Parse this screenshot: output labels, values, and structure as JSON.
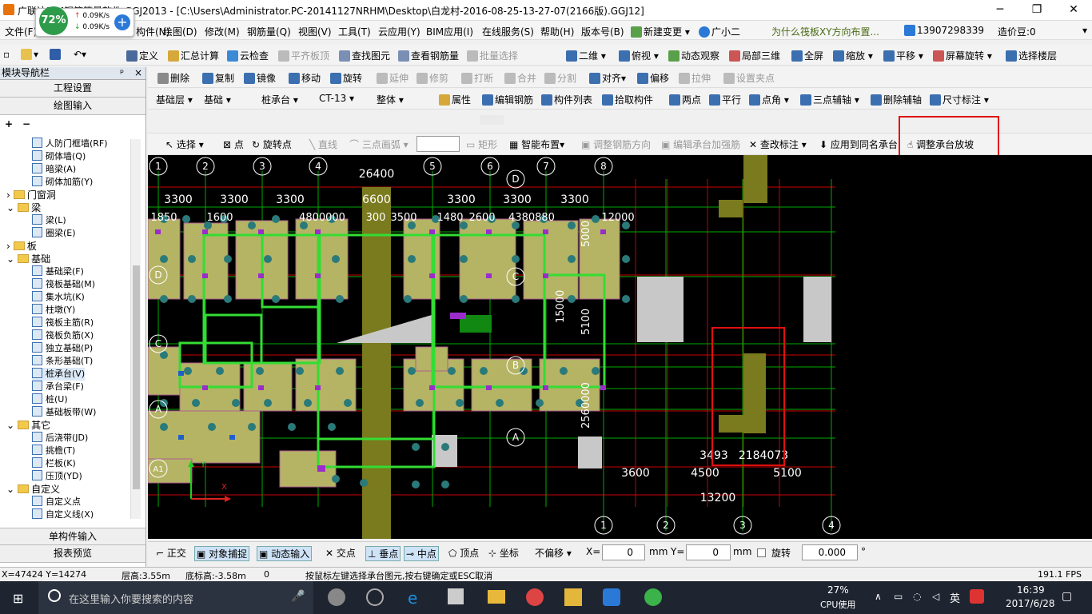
{
  "window": {
    "title": "广联达BIM钢筋算量软件 GGJ2013 - [C:\\Users\\Administrator.PC-20141127NRHM\\Desktop\\白龙村-2016-08-25-13-27-07(2166版).GGJ12]",
    "minimize": "─",
    "maximize": "❐",
    "close": "✕"
  },
  "speed": {
    "percent": "72%",
    "up": "0.09K/s",
    "down": "0.09K/s"
  },
  "menu": [
    "文件(F)",
    "编辑(E)",
    "楼层(L)",
    "构件(N)",
    "绘图(D)",
    "修改(M)",
    "钢筋量(Q)",
    "视图(V)",
    "工具(T)",
    "云应用(Y)",
    "BIM应用(I)",
    "在线服务(S)",
    "帮助(H)",
    "版本号(B)",
    "新建变更 ▾",
    "广小二"
  ],
  "help_question": "为什么筏板XY方向布置...",
  "phone": "13907298339",
  "price": "造价豆:0",
  "toolbar1": [
    "定义",
    "汇总计算",
    "云检查",
    "平齐板顶",
    "查找图元",
    "查看钢筋量",
    "批量选择",
    "二维",
    "俯视",
    "动态观察",
    "局部三维",
    "全屏",
    "缩放",
    "平移",
    "屏幕旋转",
    "选择楼层"
  ],
  "toolbar2": [
    "删除",
    "复制",
    "镜像",
    "移动",
    "旋转",
    "延伸",
    "修剪",
    "打断",
    "合并",
    "分割",
    "对齐",
    "偏移",
    "拉伸",
    "设置夹点"
  ],
  "toolbar3": {
    "floor_type": "基础层",
    "floor": "基础",
    "component_type": "桩承台",
    "component": "CT-13",
    "mode": "整体",
    "items": [
      "属性",
      "编辑钢筋",
      "构件列表",
      "拾取构件",
      "两点",
      "平行",
      "点角",
      "三点辅轴",
      "删除辅轴",
      "尺寸标注"
    ]
  },
  "toolbar4": {
    "items": [
      "选择",
      "点",
      "旋转点",
      "直线",
      "三点画弧",
      "矩形",
      "智能布置",
      "调整钢筋方向",
      "编辑承台加强筋",
      "查改标注",
      "应用到同名承台",
      "调整承台放坡"
    ]
  },
  "panel": {
    "title": "模块导航栏",
    "pin": "ᵖ",
    "close": "×",
    "btn_project": "工程设置",
    "btn_draw": "绘图输入",
    "btn_single": "单构件输入",
    "btn_report": "报表预览"
  },
  "tree": [
    {
      "t": "人防门框墙(RF)",
      "lvl": 2
    },
    {
      "t": "砌体墙(Q)",
      "lvl": 2
    },
    {
      "t": "暗梁(A)",
      "lvl": 2
    },
    {
      "t": "砌体加筋(Y)",
      "lvl": 2
    },
    {
      "t": "门窗洞",
      "lvl": 1,
      "g": true,
      "s": "›"
    },
    {
      "t": "梁",
      "lvl": 1,
      "g": true,
      "s": "⌄"
    },
    {
      "t": "梁(L)",
      "lvl": 2
    },
    {
      "t": "圈梁(E)",
      "lvl": 2
    },
    {
      "t": "板",
      "lvl": 1,
      "g": true,
      "s": "›"
    },
    {
      "t": "基础",
      "lvl": 1,
      "g": true,
      "s": "⌄"
    },
    {
      "t": "基础梁(F)",
      "lvl": 2
    },
    {
      "t": "筏板基础(M)",
      "lvl": 2
    },
    {
      "t": "集水坑(K)",
      "lvl": 2
    },
    {
      "t": "柱墩(Y)",
      "lvl": 2
    },
    {
      "t": "筏板主筋(R)",
      "lvl": 2
    },
    {
      "t": "筏板负筋(X)",
      "lvl": 2
    },
    {
      "t": "独立基础(P)",
      "lvl": 2
    },
    {
      "t": "条形基础(T)",
      "lvl": 2
    },
    {
      "t": "桩承台(V)",
      "lvl": 2,
      "sel": true
    },
    {
      "t": "承台梁(F)",
      "lvl": 2
    },
    {
      "t": "桩(U)",
      "lvl": 2
    },
    {
      "t": "基础板带(W)",
      "lvl": 2
    },
    {
      "t": "其它",
      "lvl": 1,
      "g": true,
      "s": "⌄"
    },
    {
      "t": "后浇带(JD)",
      "lvl": 2
    },
    {
      "t": "挑檐(T)",
      "lvl": 2
    },
    {
      "t": "栏板(K)",
      "lvl": 2
    },
    {
      "t": "压顶(YD)",
      "lvl": 2
    },
    {
      "t": "自定义",
      "lvl": 1,
      "g": true,
      "s": "⌄"
    },
    {
      "t": "自定义点",
      "lvl": 2
    },
    {
      "t": "自定义线(X)",
      "lvl": 2
    }
  ],
  "cad": {
    "axis_top": [
      "1",
      "2",
      "3",
      "4",
      "5",
      "6",
      "7",
      "8"
    ],
    "axis_right": [
      "1",
      "2",
      "3",
      "4"
    ],
    "axis_left": [
      "A1",
      "A",
      "C",
      "D"
    ],
    "axis_mid": [
      "D",
      "C",
      "B",
      "A"
    ],
    "dims_top": [
      "26400",
      "3300",
      "3300",
      "3300",
      "3300",
      "3300",
      "3300",
      "6600"
    ],
    "dims_2": [
      "1850",
      "1600",
      "4800000",
      "300",
      "3500",
      "1480",
      "2600",
      "4380880",
      "12000"
    ],
    "dims_right": [
      "3600",
      "4500",
      "5100",
      "13200",
      "3493",
      "2184073"
    ],
    "dims_vert": [
      "15000",
      "5100",
      "2560000",
      "5000"
    ]
  },
  "status": {
    "items": [
      "正交",
      "对象捕捉",
      "动态输入",
      "交点",
      "垂点",
      "中点",
      "顶点",
      "坐标",
      "不偏移"
    ],
    "x_label": "X=",
    "x_val": "0",
    "y_label": "Y=",
    "y_val": "0",
    "mm": "mm",
    "rotate": "旋转",
    "rotate_val": "0.000",
    "deg": "°"
  },
  "info": {
    "coord": "X=47424 Y=14274",
    "floor_h": "层高:3.55m",
    "base_h": "底标高:-3.58m",
    "zero": "0",
    "hint": "按鼠标左键选择承台图元,按右键确定或ESC取消",
    "fps": "191.1 FPS"
  },
  "taskbar": {
    "search": "在这里输入你要搜索的内容",
    "cpu": "27%",
    "cpu_label": "CPU使用",
    "ime": "英",
    "time": "16:39",
    "date": "2017/6/28"
  }
}
